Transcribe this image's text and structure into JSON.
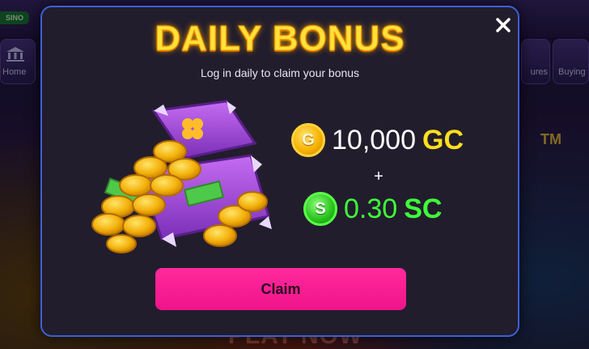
{
  "background": {
    "brand_label": "SINO",
    "nav": {
      "home_label": "Home",
      "features_label": "ures",
      "buying_label": "Buying"
    },
    "tm_label": "TM",
    "play_label": "PLAY NOW"
  },
  "modal": {
    "title": "DAILY BONUS",
    "subtitle": "Log in daily to claim your bonus",
    "close_icon": "close-icon",
    "rewards": {
      "gc": {
        "coin_letter": "G",
        "amount": "10,000",
        "currency": "GC"
      },
      "plus": "+",
      "sc": {
        "coin_letter": "S",
        "amount": "0.30",
        "currency": "SC"
      }
    },
    "claim_label": "Claim"
  },
  "colors": {
    "title": "#ffe23a",
    "claim_button": "#ff2a9c",
    "gc_accent": "#ffdf1f",
    "sc_accent": "#3fff3a",
    "modal_border": "#3d5fd6",
    "modal_bg": "#221d2c"
  }
}
